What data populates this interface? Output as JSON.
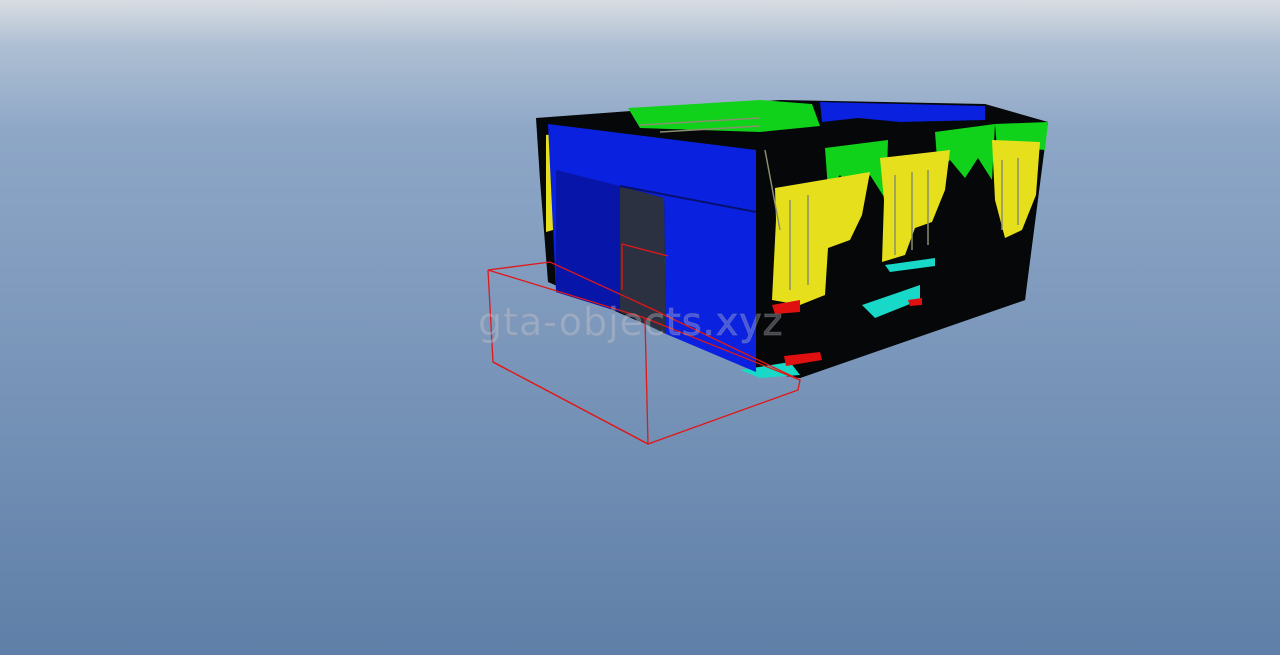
{
  "scene": {
    "type": "gta-object-model-preview",
    "colors": {
      "sky_top": "#d9dde3",
      "sky_horizon": "#aebfd3",
      "ground_far": "#8ea7c7",
      "ground_near": "#5f7fa8",
      "wall_blue": "#0a21e0",
      "wall_blue_dark": "#0716a8",
      "panel_green": "#10d21a",
      "panel_yellow": "#e6e01c",
      "floor_cyan": "#18d8c8",
      "accent_red": "#e01010",
      "structure_black": "#050708",
      "bounding_box": "#e01818"
    },
    "object": "walled-building-model",
    "bounding_box": "wireframe-bounding-box"
  },
  "watermark": {
    "text": "gta-objects.xyz"
  }
}
